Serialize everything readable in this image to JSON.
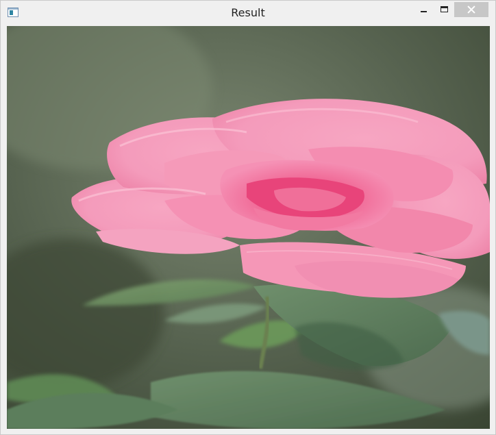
{
  "window": {
    "title": "Result",
    "icons": {
      "app": "app-window-icon",
      "minimize": "minimize-icon",
      "maximize": "maximize-icon",
      "close": "close-icon"
    }
  },
  "content": {
    "image_subject": "pink-rose-photo",
    "colors": {
      "background_dark": "#3f4a3c",
      "background_mid": "#66725f",
      "petal_pink": "#f49bbb",
      "petal_deep": "#e8447a",
      "leaf_green": "#5d7d5e"
    }
  }
}
